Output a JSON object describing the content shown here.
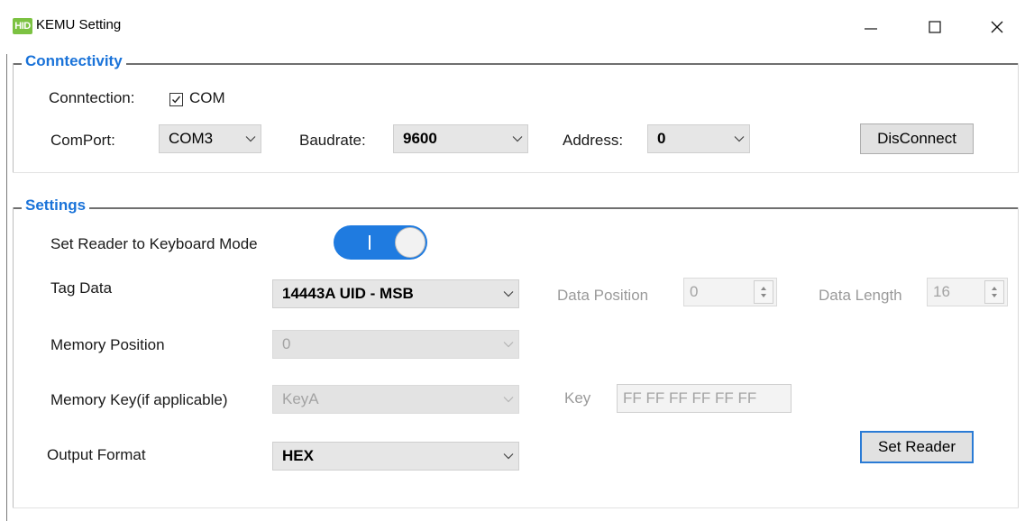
{
  "window": {
    "app_icon_text": "HID",
    "title": "KEMU Setting",
    "icons": {
      "minimize": "minimize-icon",
      "maximize": "maximize-icon",
      "close": "close-icon"
    }
  },
  "connectivity": {
    "legend": "Conntectivity",
    "connection_label": "Conntection:",
    "com_checkbox_checked": true,
    "com_label": "COM",
    "comport_label": "ComPort:",
    "comport_value": "COM3",
    "baudrate_label": "Baudrate:",
    "baudrate_value": "9600",
    "address_label": "Address:",
    "address_value": "0",
    "disconnect_label": "DisConnect"
  },
  "settings": {
    "legend": "Settings",
    "keyboard_mode_label": "Set Reader to Keyboard Mode",
    "keyboard_mode_on": true,
    "keyboard_mode_on_glyph": "I",
    "tag_data_label": "Tag Data",
    "tag_data_value": "14443A UID - MSB",
    "data_position_label": "Data Position",
    "data_position_value": "0",
    "data_length_label": "Data Length",
    "data_length_value": "16",
    "memory_position_label": "Memory Position",
    "memory_position_value": "0",
    "memory_key_label": "Memory Key(if applicable)",
    "memory_key_value": "KeyA",
    "key_label": "Key",
    "key_value": "FF FF FF FF FF FF",
    "output_format_label": "Output Format",
    "output_format_value": "HEX",
    "set_reader_label": "Set Reader"
  }
}
